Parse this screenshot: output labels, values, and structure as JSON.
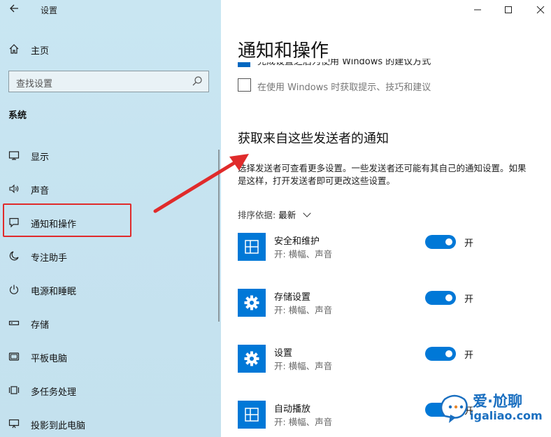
{
  "app": {
    "title": "设置"
  },
  "sidebar": {
    "home_label": "主页",
    "search_placeholder": "查找设置",
    "section_title": "系统",
    "items": [
      {
        "label": "显示",
        "icon": "display-icon"
      },
      {
        "label": "声音",
        "icon": "speaker-icon"
      },
      {
        "label": "通知和操作",
        "icon": "notification-icon"
      },
      {
        "label": "专注助手",
        "icon": "moon-icon"
      },
      {
        "label": "电源和睡眠",
        "icon": "power-icon"
      },
      {
        "label": "存储",
        "icon": "storage-icon"
      },
      {
        "label": "平板电脑",
        "icon": "tablet-icon"
      },
      {
        "label": "多任务处理",
        "icon": "multitask-icon"
      },
      {
        "label": "投影到此电脑",
        "icon": "project-icon"
      }
    ]
  },
  "main": {
    "page_title": "通知和操作",
    "cut_off_checkbox_text": "完成设置之后为使用 Windows 的建议方式",
    "tips_checkbox_label": "在使用 Windows 时获取提示、技巧和建议",
    "senders_heading": "获取来自这些发送者的通知",
    "senders_description": "选择发送者可查看更多设置。一些发送者还可能有其自己的通知设置。如果是这样，打开发送者即可更改这些设置。",
    "sort_label": "排序依据:",
    "sort_value": "最新",
    "apps": [
      {
        "name": "安全和维护",
        "sub": "开: 横幅、声音",
        "toggle_label": "开",
        "icon": "grid-icon",
        "enabled": true
      },
      {
        "name": "存储设置",
        "sub": "开: 横幅、声音",
        "toggle_label": "开",
        "icon": "gear-icon",
        "enabled": true
      },
      {
        "name": "设置",
        "sub": "开: 横幅、声音",
        "toggle_label": "开",
        "icon": "gear-icon",
        "enabled": true
      },
      {
        "name": "自动播放",
        "sub": "开: 横幅、声音",
        "toggle_label": "开",
        "icon": "grid-icon",
        "enabled": true
      }
    ]
  },
  "watermark": {
    "title": "爱·尬聊",
    "subtitle": "igaliao.com"
  },
  "colors": {
    "accent": "#0078d7",
    "sidebar_bg": "#c6e3f0",
    "annotation_red": "#e02b2b"
  }
}
